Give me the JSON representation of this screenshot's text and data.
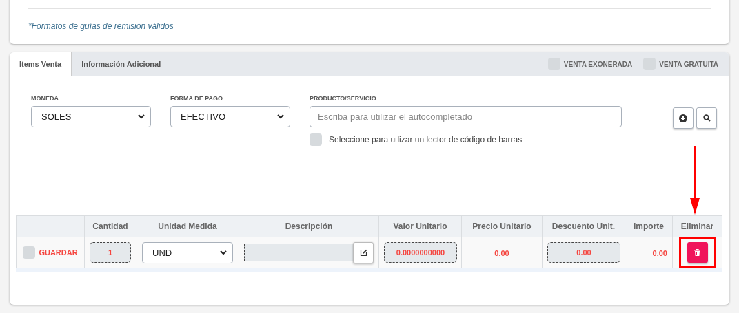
{
  "top_card": {
    "note": "*Formatos de guías de remisión válidos"
  },
  "tabs": [
    {
      "label": "Items Venta",
      "selected": true
    },
    {
      "label": "Información Adicional",
      "selected": false
    }
  ],
  "tab_options": [
    {
      "label": "VENTA EXONERADA",
      "checked": false
    },
    {
      "label": "VENTA GRATUITA",
      "checked": false
    }
  ],
  "form": {
    "moneda": {
      "label": "MONEDA",
      "value": "SOLES"
    },
    "forma_pago": {
      "label": "FORMA DE PAGO",
      "value": "EFECTIVO"
    },
    "producto": {
      "label": "PRODUCTO/SERVICIO",
      "placeholder": "Escriba para utilizar el autocompletado"
    },
    "barcode": {
      "label": "Seleccione para utlizar un lector de código de barras",
      "checked": false
    }
  },
  "table": {
    "columns": [
      "",
      "Cantidad",
      "Unidad Medida",
      "Descripción",
      "Valor Unitario",
      "Precio Unitario",
      "Descuento Unit.",
      "Importe",
      "Eliminar"
    ],
    "rows": [
      {
        "save": {
          "label": "GUARDAR",
          "checked": false
        },
        "cantidad": "1",
        "unidad": "UND",
        "valor_unitario": "0.0000000000",
        "precio_unitario": "0.00",
        "descuento": "0.00",
        "importe": "0.00",
        "delete_highlighted": true
      }
    ]
  },
  "annotation_arrow": true
}
